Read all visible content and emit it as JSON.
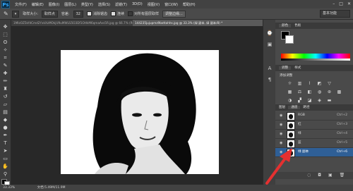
{
  "menubar": {
    "logo": "Ps",
    "items": [
      "文件(F)",
      "编辑(E)",
      "图像(I)",
      "图层(L)",
      "类型(Y)",
      "选择(S)",
      "滤镜(T)",
      "3D(D)",
      "视图(V)",
      "窗口(W)",
      "帮助(H)"
    ],
    "controls": {
      "minimize": "–",
      "maximize": "□",
      "close": "✕"
    }
  },
  "options": {
    "style_label": "样式:",
    "style_value": "正常",
    "size_label": "取样大小:",
    "size_value": "取样点",
    "tolerance_label": "容差:",
    "tolerance_value": "32",
    "antialias": "消除锯齿",
    "contiguous": "连续",
    "all_layers": "对所有图层取样",
    "refine_button": "调整边缘...",
    "workspace": "基本功能"
  },
  "tabs": [
    {
      "label": "1MIzOZ5kfdCmd2YxkXzMOkjU9uMWLS5O3Df1OHkM6qmaAvs5R.jpg @ 66.7% (RGB/8#)",
      "active": false
    },
    {
      "label": "144235jujupmz9bxttahhs.jpg @ 33.3% (绿 副本, 绿 副本/8) *",
      "active": true
    }
  ],
  "status": {
    "zoom": "33.33%",
    "doc": "文档:5.49M/11.9M"
  },
  "panels": {
    "color_tabs": [
      "颜色",
      "色板"
    ],
    "adjust_tabs": [
      "调整",
      "样式"
    ],
    "adjust_title": "添加调整",
    "channel_tabs": [
      "图层",
      "通道",
      "路径"
    ],
    "channels": [
      {
        "name": "RGB",
        "shortcut": "Ctrl+2",
        "selected": false
      },
      {
        "name": "红",
        "shortcut": "Ctrl+3",
        "selected": false
      },
      {
        "name": "绿",
        "shortcut": "Ctrl+4",
        "selected": false
      },
      {
        "name": "蓝",
        "shortcut": "Ctrl+5",
        "selected": false
      },
      {
        "name": "绿 副本",
        "shortcut": "Ctrl+6",
        "selected": true
      }
    ]
  },
  "colors": {
    "accent_selected": "#2f5f96",
    "arrow": "#e53030"
  }
}
